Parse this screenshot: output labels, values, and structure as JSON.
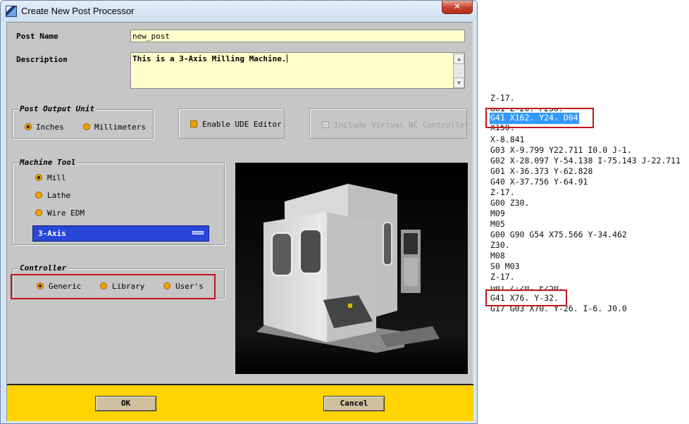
{
  "window": {
    "title": "Create New Post Processor",
    "close_glyph": "✕"
  },
  "post_name": {
    "label": "Post Name",
    "value": "new_post"
  },
  "description": {
    "label": "Description",
    "value": "This is a 3-Axis Milling Machine."
  },
  "output_unit": {
    "legend": "Post Output Unit",
    "options": [
      {
        "label": "Inches",
        "selected": true
      },
      {
        "label": "Millimeters",
        "selected": false
      }
    ]
  },
  "ude_editor": {
    "label": "Enable UDE Editor",
    "checked": true
  },
  "virtual_nc": {
    "label": "Include Virtual NC Controller",
    "checked": false,
    "enabled": false
  },
  "machine_tool": {
    "legend": "Machine Tool",
    "options": [
      {
        "label": "Mill",
        "selected": true
      },
      {
        "label": "Lathe",
        "selected": false
      },
      {
        "label": "Wire EDM",
        "selected": false
      }
    ],
    "axis_selected": "3-Axis"
  },
  "controller": {
    "legend": "Controller",
    "options": [
      {
        "label": "Generic",
        "selected": true
      },
      {
        "label": "Library",
        "selected": false
      },
      {
        "label": "User's",
        "selected": false
      }
    ]
  },
  "buttons": {
    "ok": "OK",
    "cancel": "Cancel"
  },
  "nc_code": {
    "lines": [
      "Z-17.",
      "G01 Z-20. F250.",
      "G41 X162. Y24. D04",
      "X150.",
      "X-8.841",
      "G03 X-9.799 Y22.711 I0.0 J-1.",
      "G02 X-28.097 Y-54.138 I-75.143 J-22.711",
      "G01 X-36.373 Y-62.828",
      "G40 X-37.756 Y-64.91",
      "Z-17.",
      "G00 Z30.",
      "M09",
      "M05",
      "G00 G90 G54 X75.566 Y-34.462",
      "Z30.",
      "M08",
      "S0 M03",
      "Z-17.",
      "G01 Z-20. F250.",
      "G41 X76. Y-32.",
      "G17 G03 X70. Y-26. I-6. J0.0"
    ],
    "highlighted_line_index": 2
  },
  "colors": {
    "dialog_bg": "#c6c6c6",
    "field_bg": "#ffffcc",
    "footer_bg": "#ffd400",
    "option_menu_bg": "#2846d8",
    "radio_color": "#f0a000",
    "highlight_box": "#c0151b",
    "selection": "#3399ff"
  }
}
